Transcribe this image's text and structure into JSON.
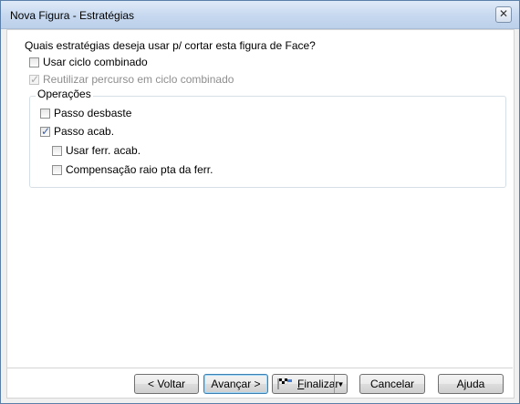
{
  "window": {
    "title": "Nova Figura - Estratégias",
    "close_glyph": "✕"
  },
  "question": "Quais estratégias deseja usar p/ cortar esta figura de Face?",
  "options": {
    "usar_ciclo": {
      "label": "Usar ciclo combinado",
      "checked": false
    },
    "reutilizar": {
      "label": "Reutilizar percurso em ciclo combinado",
      "checked": true,
      "disabled": true
    }
  },
  "operacoes": {
    "title": "Operações",
    "passo_desbaste": {
      "label": "Passo desbaste",
      "checked": false
    },
    "passo_acab": {
      "label": "Passo acab.",
      "checked": true
    },
    "usar_ferr_acab": {
      "label": "Usar ferr. acab.",
      "checked": false
    },
    "compensacao": {
      "label": "Compensação raio pta da ferr.",
      "checked": false
    }
  },
  "buttons": {
    "voltar": "< Voltar",
    "avancar": "Avançar >",
    "finalizar_first": "F",
    "finalizar_rest": "inalizar",
    "cancelar": "Cancelar",
    "ajuda": "Ajuda"
  }
}
